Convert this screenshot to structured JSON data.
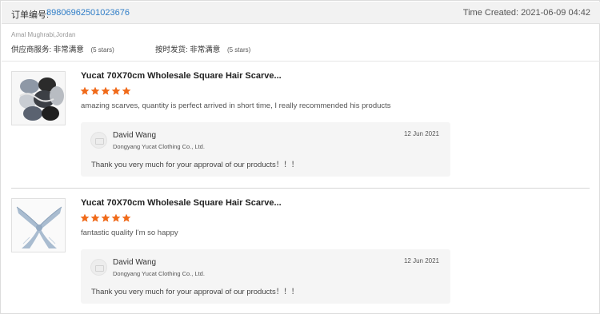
{
  "order": {
    "label": "订单编号:",
    "number": "89806962501023676",
    "time_created": "Time Created: 2021-06-09 04:42"
  },
  "buyer": {
    "name_location": "Amal Mughrabi,Jordan",
    "ratings": [
      {
        "label": "供应商服务:",
        "value": "非常满意",
        "stars_note": "(5 stars)",
        "stars": 5
      },
      {
        "label": "按时发货:",
        "value": "非常满意",
        "stars_note": "(5 stars)",
        "stars": 5
      }
    ]
  },
  "colors": {
    "star": "#f06a1a",
    "link": "#2f7dc7",
    "reply_bg": "#f5f5f5",
    "header_bg": "#f2f2f2"
  },
  "reviews": [
    {
      "product_title": "Yucat 70X70cm Wholesale Square Hair Scarve...",
      "rating": 5,
      "text": "amazing scarves, quantity is perfect arrived in short time, I really recommended his products",
      "image_icon": "scarf-bundle-image",
      "reply": {
        "name": "David Wang",
        "company": "Dongyang Yucat Clothing Co., Ltd.",
        "date": "12 Jun 2021",
        "message": "Thank you very much for your approval of our products！！！"
      }
    },
    {
      "product_title": "Yucat 70X70cm Wholesale Square Hair Scarve...",
      "rating": 5,
      "text": "fantastic quality I'm so happy",
      "image_icon": "tied-scarf-image",
      "reply": {
        "name": "David Wang",
        "company": "Dongyang Yucat Clothing Co., Ltd.",
        "date": "12 Jun 2021",
        "message": "Thank you very much for your approval of our products！！！"
      }
    }
  ]
}
